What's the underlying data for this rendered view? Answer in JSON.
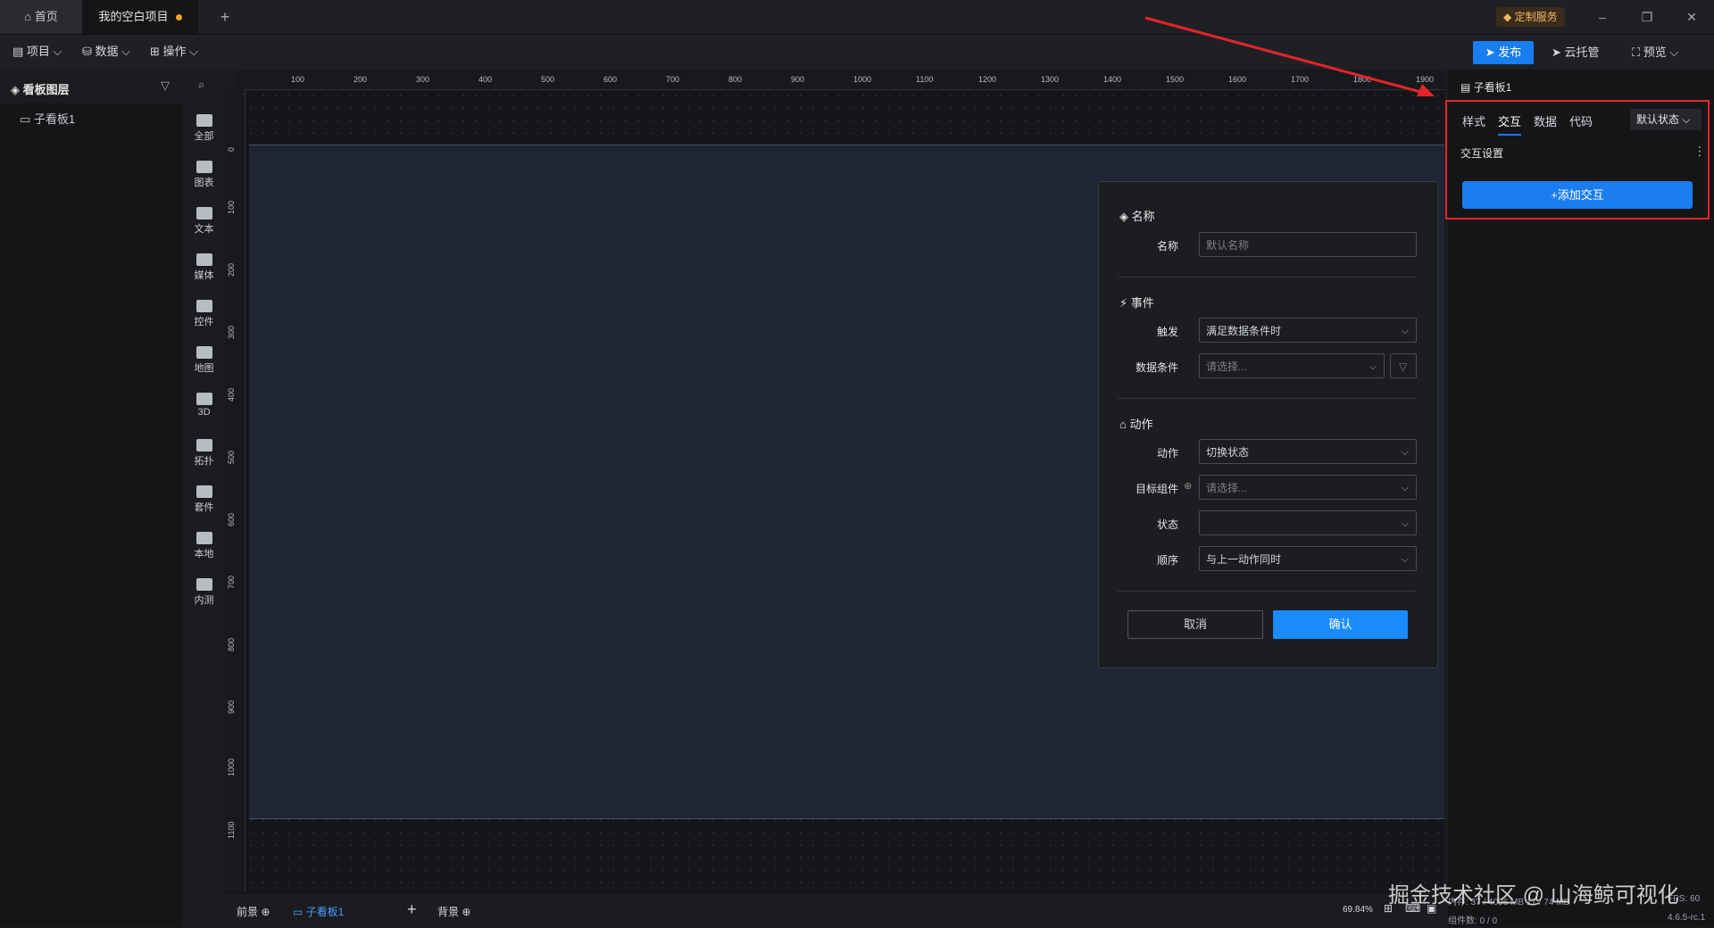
{
  "tabs": {
    "home": "首页",
    "project": "我的空白项目",
    "add": "+"
  },
  "header": {
    "custom_service": "定制服务",
    "window_min": "–",
    "window_max": "❐",
    "window_close": "✕"
  },
  "menubar": {
    "project": "项目",
    "data": "数据",
    "operation": "操作",
    "publish": "发布",
    "cloud": "云托管",
    "preview": "预览"
  },
  "layers": {
    "title": "看板图层",
    "item": "子看板1"
  },
  "components": [
    {
      "label": "全部",
      "icon": "grid-icon"
    },
    {
      "label": "图表",
      "icon": "bar-chart-icon"
    },
    {
      "label": "文本",
      "icon": "text-icon"
    },
    {
      "label": "媒体",
      "icon": "media-icon"
    },
    {
      "label": "控件",
      "icon": "control-icon"
    },
    {
      "label": "地图",
      "icon": "map-icon"
    },
    {
      "label": "3D",
      "icon": "cube-icon"
    },
    {
      "label": "拓扑",
      "icon": "topology-icon"
    },
    {
      "label": "套件",
      "icon": "kit-icon"
    },
    {
      "label": "本地",
      "icon": "puzzle-icon"
    },
    {
      "label": "内测",
      "icon": "beta-icon"
    }
  ],
  "ruler": {
    "top": [
      "100",
      "200",
      "300",
      "400",
      "500",
      "600",
      "700",
      "800",
      "900",
      "1000",
      "1100",
      "1200",
      "1300",
      "1400",
      "1500",
      "1600",
      "1700",
      "1800",
      "1900"
    ],
    "left": [
      "0",
      "100",
      "200",
      "300",
      "400",
      "500",
      "600",
      "700",
      "800",
      "900",
      "1000",
      "1100"
    ]
  },
  "dialog": {
    "name_section": "名称",
    "name_label": "名称",
    "name_placeholder": "默认名称",
    "event_section": "事件",
    "trigger_label": "触发",
    "trigger_value": "满足数据条件时",
    "condition_label": "数据条件",
    "condition_placeholder": "请选择...",
    "action_section": "动作",
    "action_label": "动作",
    "action_value": "切换状态",
    "target_label": "目标组件",
    "target_placeholder": "请选择...",
    "state_label": "状态",
    "state_value": "",
    "order_label": "顺序",
    "order_value": "与上一动作同时",
    "cancel": "取消",
    "confirm": "确认"
  },
  "right_panel": {
    "title": "子看板1",
    "tabs": [
      "样式",
      "交互",
      "数据",
      "代码"
    ],
    "active_tab": "交互",
    "state": "默认状态",
    "settings": "交互设置",
    "add_interaction": "+添加交互"
  },
  "bottombar": {
    "foreground": "前景",
    "active_board": "子看板1",
    "add": "+",
    "background": "背景",
    "zoom": "69.84%"
  },
  "watermark": "掘金技术社区 @ 山海鲸可视化",
  "stats": {
    "memory": "内存: 37 / 4096 MB 17 / 74 MB",
    "fps": "FPS: 60",
    "count": "组件数: 0 / 0",
    "version": "4.6.5-rc.1"
  },
  "colors": {
    "accent": "#1a7df0",
    "highlight": "#e3242b",
    "modified_dot": "#f5a623"
  }
}
